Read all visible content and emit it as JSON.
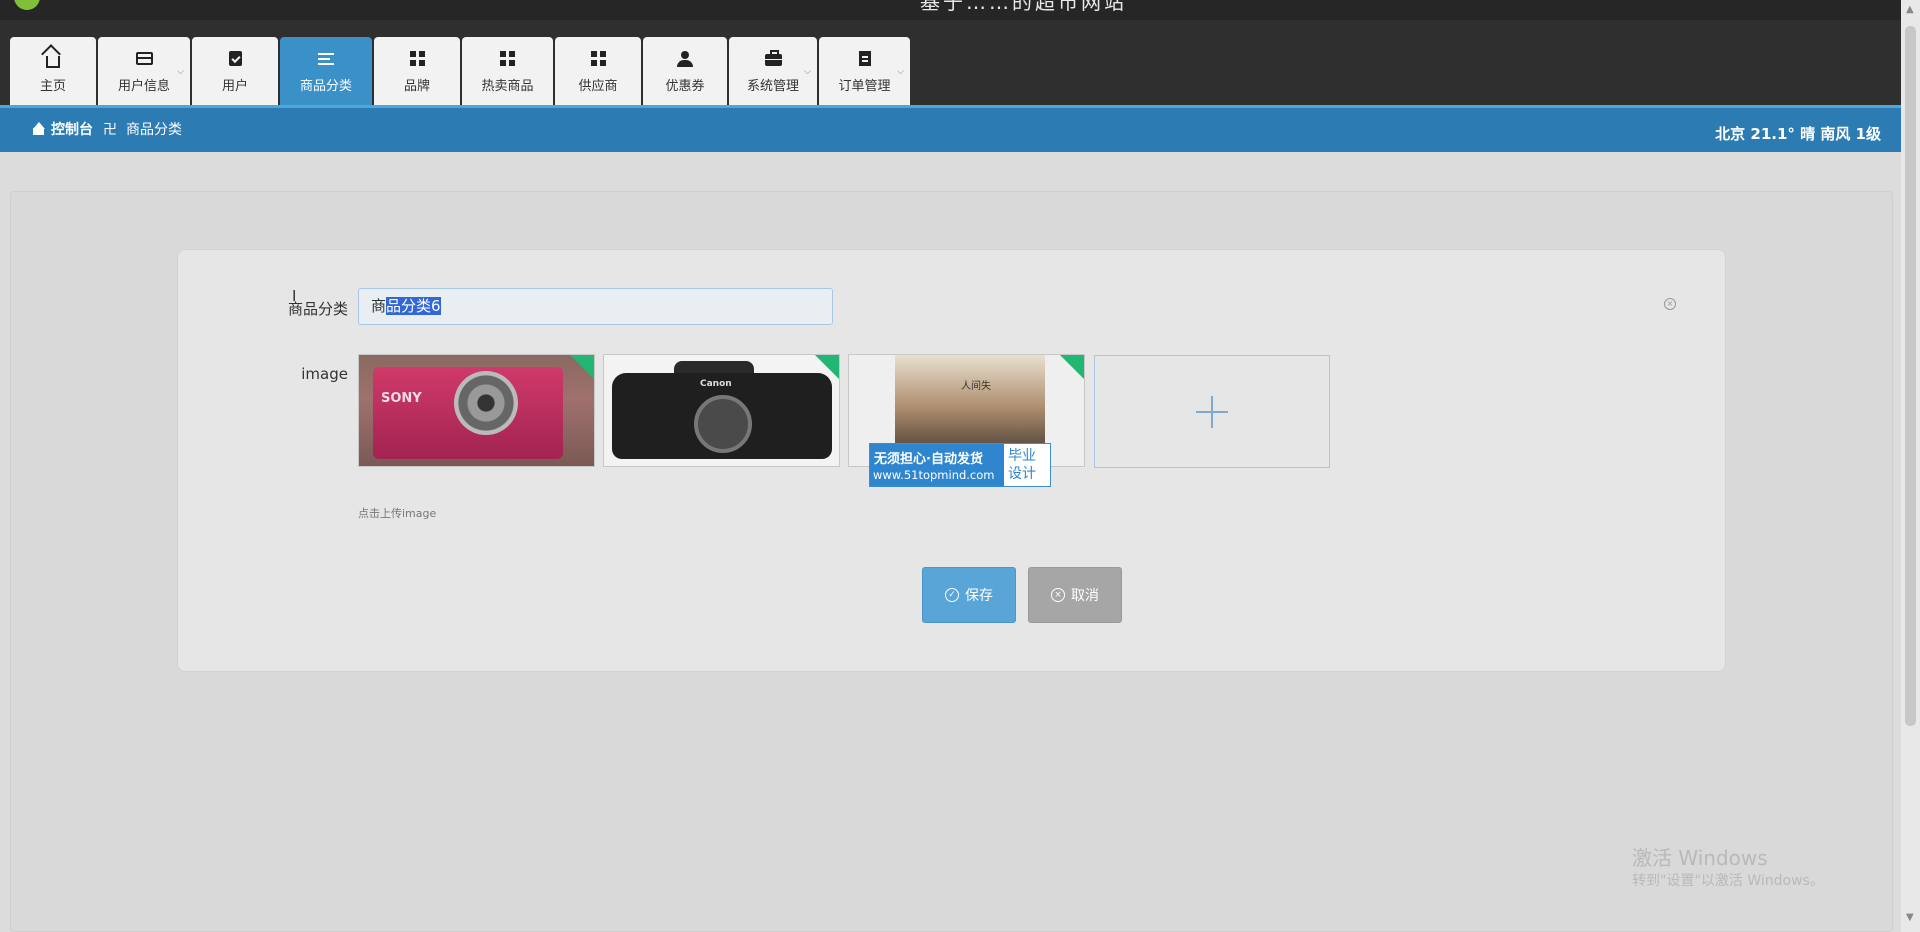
{
  "app": {
    "title": "基于……的超市网站"
  },
  "nav": {
    "tabs": [
      {
        "label": "主页",
        "icon": "home-icon",
        "dropdown": false,
        "active": false
      },
      {
        "label": "用户信息",
        "icon": "card-icon",
        "dropdown": true,
        "active": false
      },
      {
        "label": "用户",
        "icon": "clipboard-check-icon",
        "dropdown": false,
        "active": false
      },
      {
        "label": "商品分类",
        "icon": "list-icon",
        "dropdown": false,
        "active": true
      },
      {
        "label": "品牌",
        "icon": "grid-icon",
        "dropdown": false,
        "active": false
      },
      {
        "label": "热卖商品",
        "icon": "grid-icon",
        "dropdown": false,
        "active": false
      },
      {
        "label": "供应商",
        "icon": "grid-icon",
        "dropdown": false,
        "active": false
      },
      {
        "label": "优惠券",
        "icon": "user-icon",
        "dropdown": false,
        "active": false
      },
      {
        "label": "系统管理",
        "icon": "briefcase-icon",
        "dropdown": true,
        "active": false
      },
      {
        "label": "订单管理",
        "icon": "clipboard-icon",
        "dropdown": true,
        "active": false
      }
    ]
  },
  "breadcrumb": {
    "home": "控制台",
    "separator": "卍",
    "current": "商品分类"
  },
  "weather": "北京  21.1°  晴  南风  1级",
  "form": {
    "name_label": "商品分类",
    "name_value_unselected": "商",
    "name_value_selected": "品分类6",
    "image_label": "image",
    "images": [
      {
        "name": "pink-sony-camera",
        "brand_text": "SONY"
      },
      {
        "name": "canon-dslr-body",
        "brand_text": "Canon"
      },
      {
        "name": "book-cover",
        "title_text": "人间失"
      }
    ],
    "upload_hint": "点击上传image",
    "save_label": "保存",
    "cancel_label": "取消"
  },
  "ad": {
    "line1": "无须担心·自动发货",
    "line2": "www.51topmind.com",
    "side": "毕业设计"
  },
  "windows_watermark": {
    "line1": "激活 Windows",
    "line2": "转到\"设置\"以激活 Windows。"
  },
  "colors": {
    "topbar": "#2f2f2f",
    "active_tab": "#3a91c8",
    "crumbbar": "#2c7bb3",
    "tag_green": "#22b573",
    "ad_blue": "#2f86cf"
  }
}
